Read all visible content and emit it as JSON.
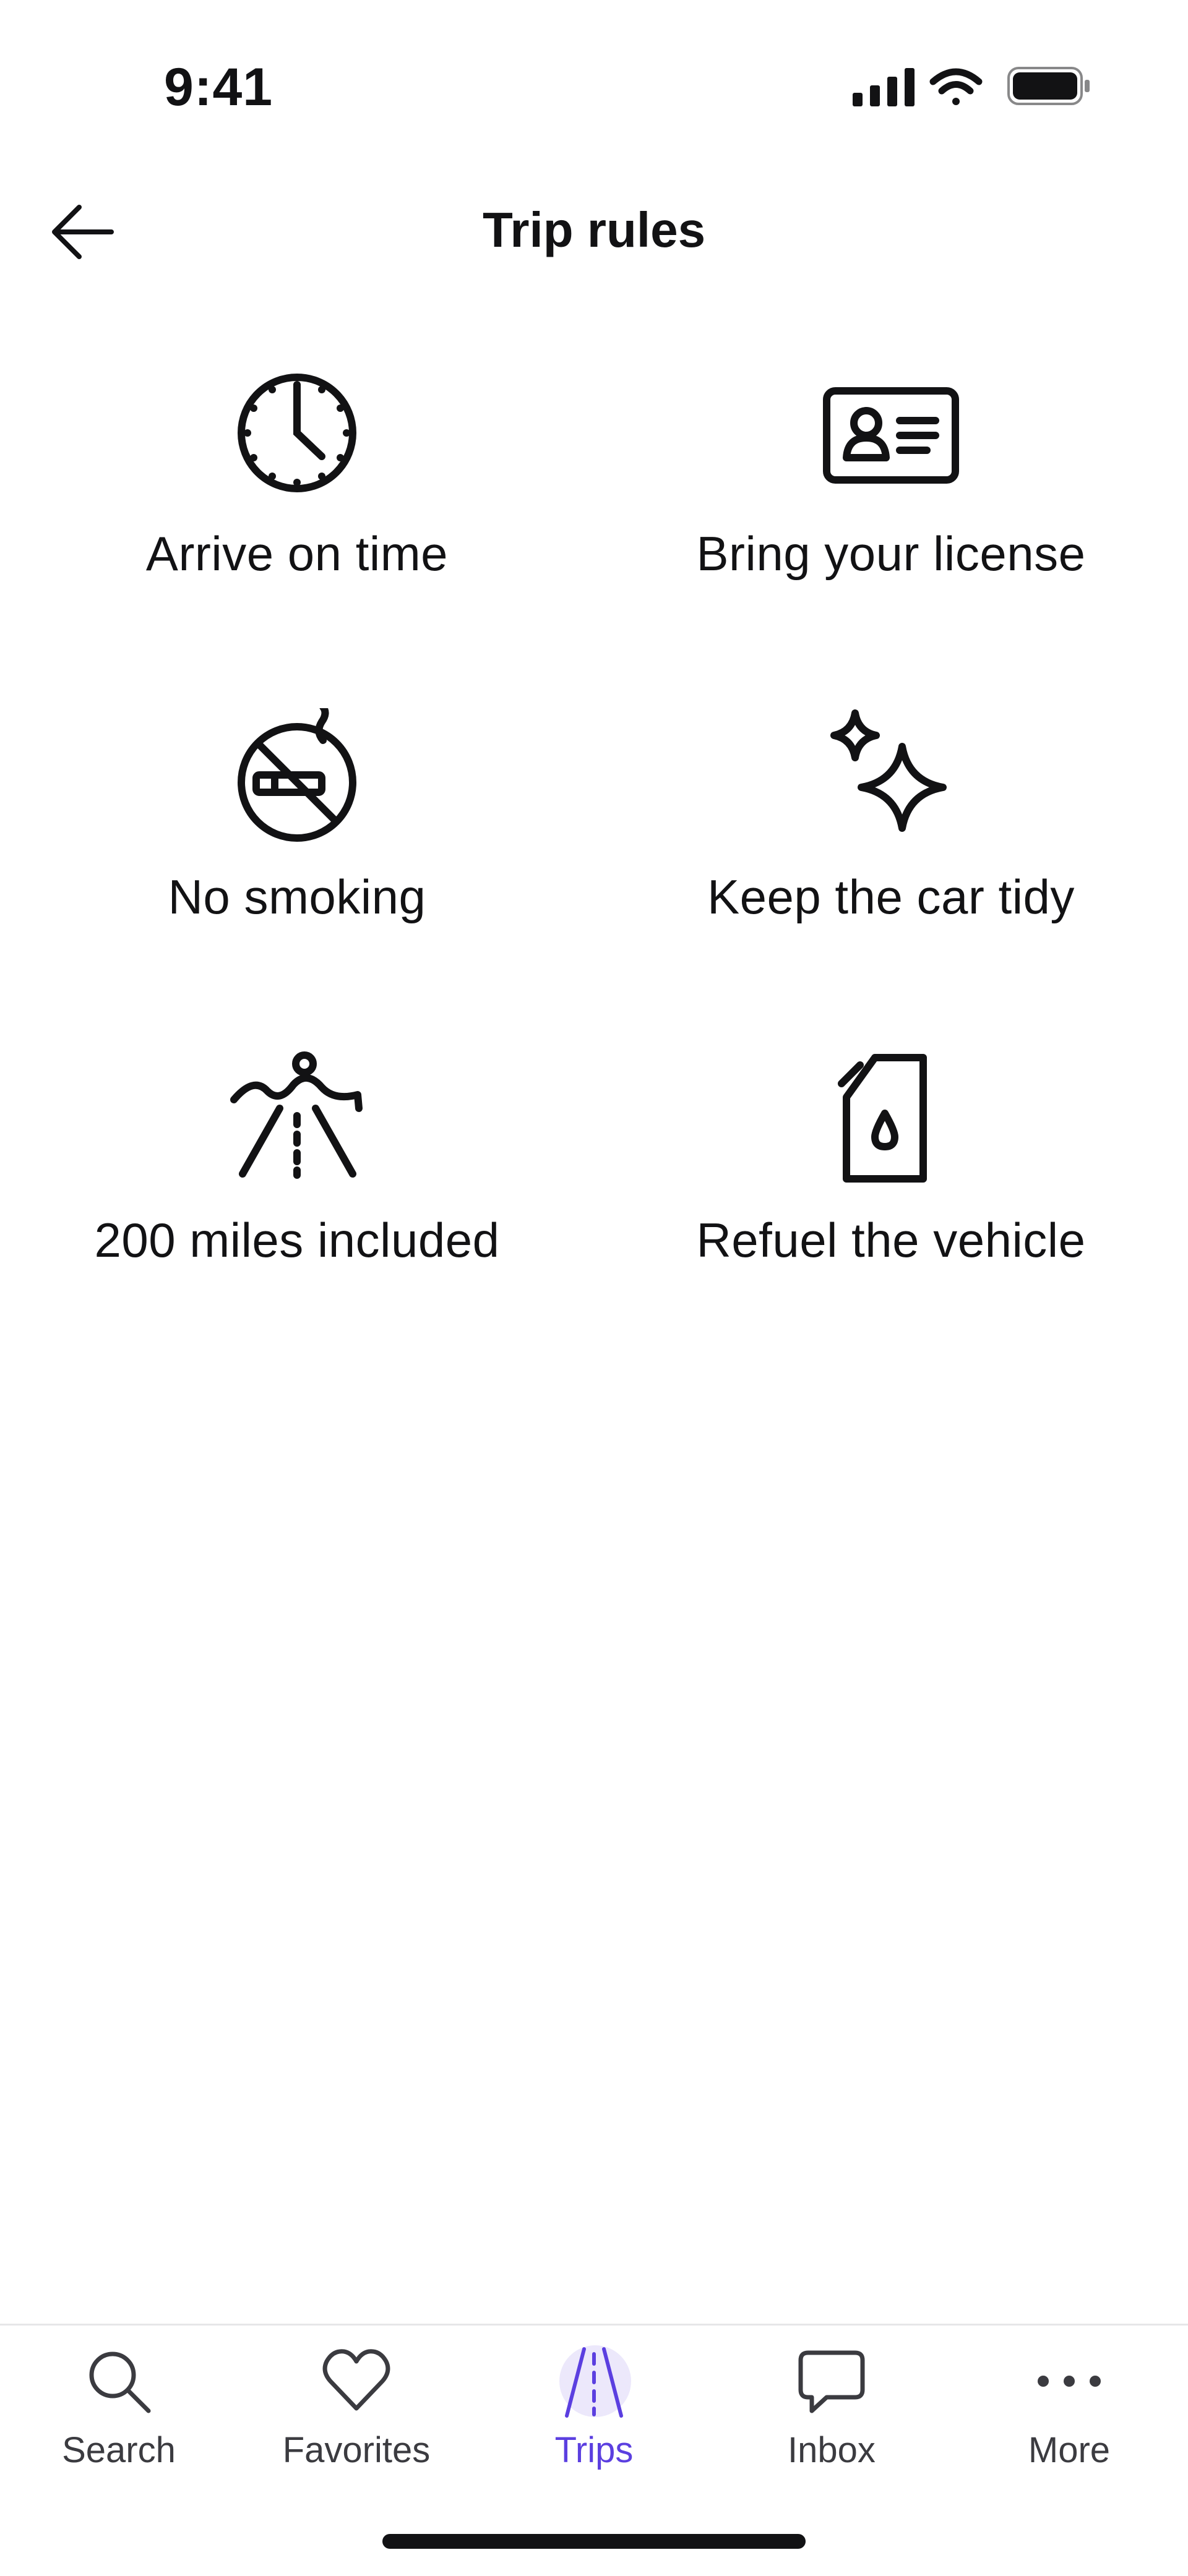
{
  "status_bar": {
    "time": "9:41",
    "icons": [
      "cellular-signal-icon",
      "wifi-icon",
      "battery-icon"
    ]
  },
  "header": {
    "title": "Trip rules",
    "back_icon": "arrow-left-icon"
  },
  "rules": [
    {
      "label": "Arrive on time",
      "icon": "clock-icon"
    },
    {
      "label": "Bring your license",
      "icon": "id-card-icon"
    },
    {
      "label": "No smoking",
      "icon": "no-smoking-icon"
    },
    {
      "label": "Keep the car tidy",
      "icon": "sparkles-icon"
    },
    {
      "label": "200 miles included",
      "icon": "road-mountains-icon"
    },
    {
      "label": "Refuel the vehicle",
      "icon": "fuel-can-icon"
    }
  ],
  "tab_bar": {
    "active_tab": "Trips",
    "active_color": "#5b3fe0",
    "tabs": [
      {
        "label": "Search",
        "icon": "search-icon"
      },
      {
        "label": "Favorites",
        "icon": "heart-icon"
      },
      {
        "label": "Trips",
        "icon": "road-icon"
      },
      {
        "label": "Inbox",
        "icon": "chat-bubble-icon"
      },
      {
        "label": "More",
        "icon": "more-dots-icon"
      }
    ]
  }
}
